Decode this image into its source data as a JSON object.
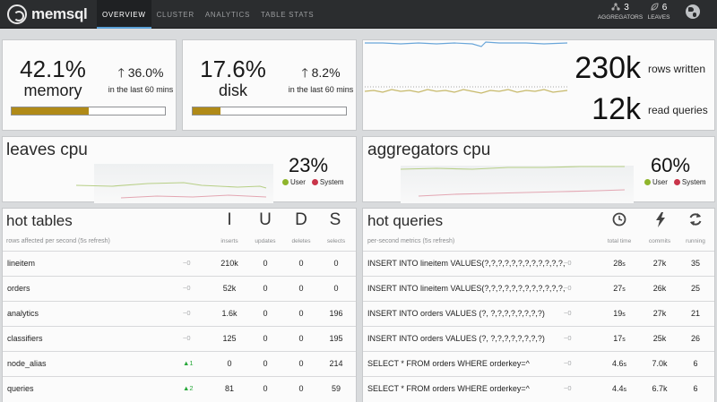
{
  "app": {
    "logo": "memsql"
  },
  "nav": {
    "tabs": [
      "OVERVIEW",
      "CLUSTER",
      "ANALYTICS",
      "TABLE STATS"
    ]
  },
  "header_stats": {
    "aggregators": {
      "count": "3",
      "label": "AGGREGATORS",
      "icon": "network-icon"
    },
    "leaves": {
      "count": "6",
      "label": "LEAVES",
      "icon": "leaf-icon"
    }
  },
  "memory": {
    "percent": "42.1%",
    "label": "memory",
    "trend": "36.0%",
    "trend_label": "in the last 60 mins",
    "bar_fraction": 0.5
  },
  "disk": {
    "percent": "17.6%",
    "label": "disk",
    "trend": "8.2%",
    "trend_label": "in the last 60 mins",
    "bar_fraction": 0.18
  },
  "throughput": {
    "rows_written": "230k",
    "rows_written_label": "rows written",
    "read_queries": "12k",
    "read_queries_label": "read queries"
  },
  "leaves_cpu": {
    "title": "leaves cpu",
    "percent": "23%",
    "legend": [
      "User",
      "System"
    ]
  },
  "aggregators_cpu": {
    "title": "aggregators cpu",
    "percent": "60%",
    "legend": [
      "User",
      "System"
    ]
  },
  "colors": {
    "accent": "#5aa0d6",
    "bar": "#b08a18",
    "user": "#8fb52c",
    "system": "#c9354a",
    "up": "#28a83a"
  },
  "hot_tables": {
    "title": "hot tables",
    "subtitle": "rows affected per second (5s refresh)",
    "columns": [
      {
        "letter": "I",
        "label": "inserts"
      },
      {
        "letter": "U",
        "label": "updates"
      },
      {
        "letter": "D",
        "label": "deletes"
      },
      {
        "letter": "S",
        "label": "selects"
      }
    ],
    "rows": [
      {
        "name": "lineitem",
        "delta": "~0",
        "up": false,
        "inserts": "210k",
        "updates": "0",
        "deletes": "0",
        "selects": "0"
      },
      {
        "name": "orders",
        "delta": "~0",
        "up": false,
        "inserts": "52k",
        "updates": "0",
        "deletes": "0",
        "selects": "0"
      },
      {
        "name": "analytics",
        "delta": "~0",
        "up": false,
        "inserts": "1.6k",
        "updates": "0",
        "deletes": "0",
        "selects": "196"
      },
      {
        "name": "classifiers",
        "delta": "~0",
        "up": false,
        "inserts": "125",
        "updates": "0",
        "deletes": "0",
        "selects": "195"
      },
      {
        "name": "node_alias",
        "delta": "▲1",
        "up": true,
        "inserts": "0",
        "updates": "0",
        "deletes": "0",
        "selects": "214"
      },
      {
        "name": "queries",
        "delta": "▲2",
        "up": true,
        "inserts": "81",
        "updates": "0",
        "deletes": "0",
        "selects": "59"
      }
    ]
  },
  "hot_queries": {
    "title": "hot queries",
    "subtitle": "per-second metrics (5s refresh)",
    "columns": [
      {
        "icon": "clock-icon",
        "label": "total time"
      },
      {
        "icon": "lightning-icon",
        "label": "commits"
      },
      {
        "icon": "refresh-icon",
        "label": "running"
      }
    ],
    "rows": [
      {
        "query": "INSERT INTO lineitem VALUES(?,?,?,?,?,?,?,?,?,?,?,?,",
        "delta": "~0",
        "time": "28",
        "unit": "s",
        "commits": "27k",
        "running": "35"
      },
      {
        "query": "INSERT INTO lineitem VALUES(?,?,?,?,?,?,?,?,?,?,?,?,",
        "delta": "~0",
        "time": "27",
        "unit": "s",
        "commits": "26k",
        "running": "25"
      },
      {
        "query": "INSERT INTO orders VALUES (?, ?,?,?,?,?,?,?,?)",
        "delta": "~0",
        "time": "19",
        "unit": "s",
        "commits": "27k",
        "running": "21"
      },
      {
        "query": "INSERT INTO orders VALUES (?, ?,?,?,?,?,?,?,?)",
        "delta": "~0",
        "time": "17",
        "unit": "s",
        "commits": "25k",
        "running": "26"
      },
      {
        "query": "SELECT * FROM orders WHERE orderkey=^",
        "delta": "~0",
        "time": "4.6",
        "unit": "s",
        "commits": "7.0k",
        "running": "6"
      },
      {
        "query": "SELECT * FROM orders WHERE orderkey=^",
        "delta": "~0",
        "time": "4.4",
        "unit": "s",
        "commits": "6.7k",
        "running": "6"
      }
    ]
  }
}
